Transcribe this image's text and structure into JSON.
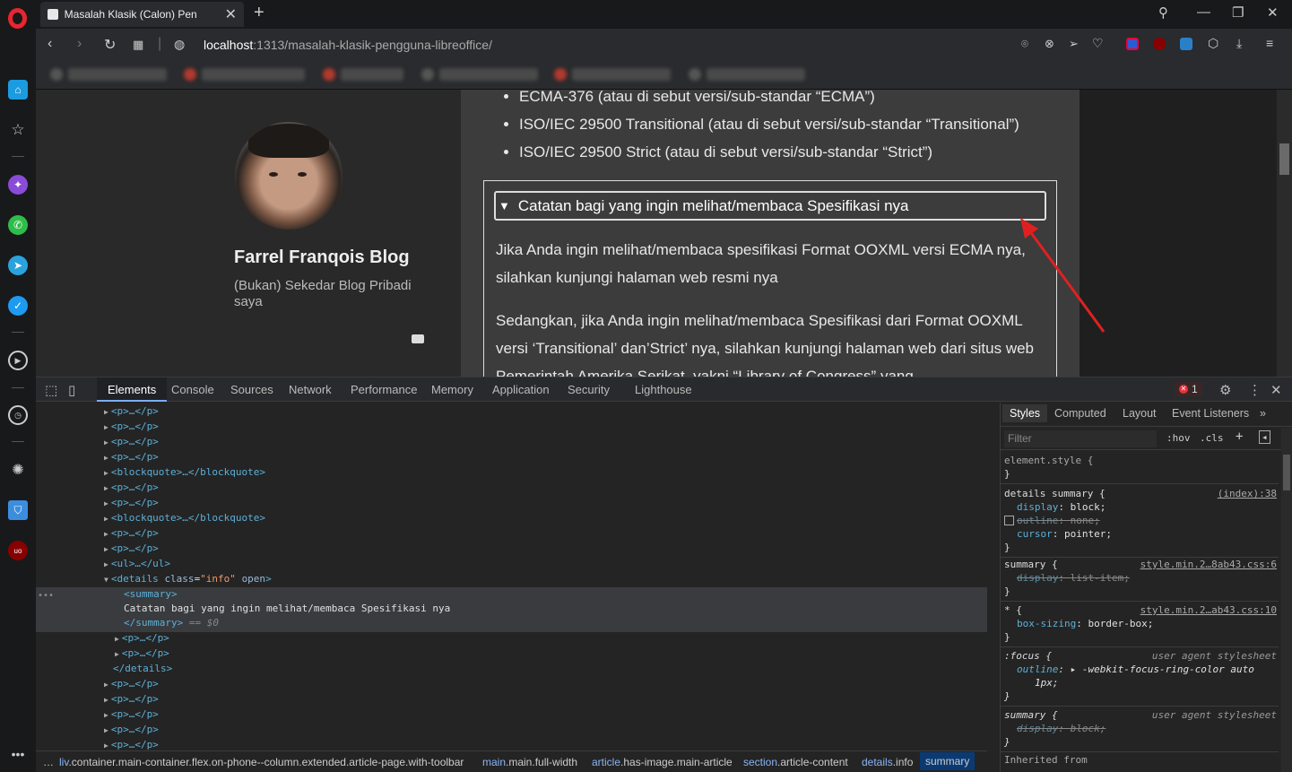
{
  "browser": {
    "tab_title": "Masalah Klasik (Calon) Pen",
    "url_host": "localhost",
    "url_path": ":1313/masalah-klasik-pengguna-libreoffice/"
  },
  "blog": {
    "title": "Farrel Franqois Blog",
    "subtitle": "(Bukan) Sekedar Blog Pribadi saya"
  },
  "article": {
    "list_items": [
      "ECMA-376 (atau di sebut versi/sub-standar “ECMA”)",
      "ISO/IEC 29500 Transitional (atau di sebut versi/sub-standar “Transitional”)",
      "ISO/IEC 29500 Strict (atau di sebut versi/sub-standar “Strict”)"
    ],
    "summary": "Catatan bagi yang ingin melihat/membaca Spesifikasi nya",
    "para1": "Jika Anda ingin melihat/membaca spesifikasi Format OOXML versi ECMA nya, silahkan kunjungi halaman web resmi nya",
    "para2": "Sedangkan, jika Anda ingin melihat/membaca Spesifikasi dari Format OOXML versi ‘Transitional’ dan’Strict’ nya, silahkan kunjungi halaman web dari situs web",
    "para2_cut": "Pemerintah Amerika Serikat, yakni “Library of Congress” yang"
  },
  "devtools": {
    "tabs": [
      "Elements",
      "Console",
      "Sources",
      "Network",
      "Performance",
      "Memory",
      "Application",
      "Security",
      "Lighthouse"
    ],
    "error_count": "1",
    "dom_lines": {
      "p": "<p>…</p>",
      "blockquote": "<blockquote>…</blockquote>",
      "ul": "<ul>…</ul>",
      "details_open_tag": "<details",
      "details_attr_name": "class",
      "details_attr_value": "\"info\"",
      "details_open_word": "open",
      "summary_open": "<summary>",
      "summary_text": "Catatan bagi yang ingin melihat/membaca Spesifikasi nya",
      "summary_close": "</summary>",
      "summary_eq": "== $0",
      "details_close": "</details>"
    },
    "breadcrumb": [
      {
        "tag": "liv",
        "cls": ".container.main-container.flex.on-phone--column.extended.article-page.with-toolbar"
      },
      {
        "tag": "main",
        "cls": ".main.full-width"
      },
      {
        "tag": "article",
        "cls": ".has-image.main-article"
      },
      {
        "tag": "section",
        "cls": ".article-content"
      },
      {
        "tag": "details",
        "cls": ".info"
      },
      {
        "tag": "summary",
        "cls": ""
      }
    ],
    "styles": {
      "tabs": [
        "Styles",
        "Computed",
        "Layout",
        "Event Listeners"
      ],
      "filter_placeholder": "Filter",
      "hov": ":hov",
      "cls": ".cls",
      "rules": {
        "element_style": "element.style {",
        "r1_sel": "details summary {",
        "r1_src": "(index):38",
        "r2_sel": "summary {",
        "r2_src": "style.min.2…8ab43.css:6",
        "r3_sel": "* {",
        "r3_src": "style.min.2…ab43.css:10",
        "r4_sel": ":focus {",
        "r4_src": "user agent stylesheet",
        "r5_sel": "summary {",
        "r5_src": "user agent stylesheet",
        "display": "display",
        "block": "block;",
        "outline": "outline",
        "none": "none;",
        "cursor": "cursor",
        "pointer": "pointer;",
        "list_item": "list-item;",
        "box_sizing": "box-sizing",
        "border_box": "border-box;",
        "focus_val": "-webkit-focus-ring-color auto",
        "focus_val2": "1px;",
        "close_brace": "}",
        "inherited": "Inherited from"
      }
    }
  }
}
